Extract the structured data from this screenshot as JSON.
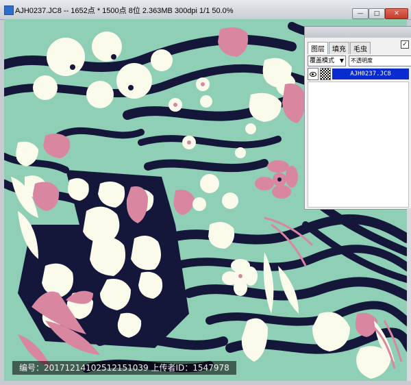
{
  "window": {
    "title": "AJH0237.JC8 -- 1652点 * 1500点 8位   2.363MB 300dpi 1/1   50.0%",
    "buttons": {
      "minimize": "—",
      "restore": "□",
      "close": "✕"
    },
    "icon": "app-icon"
  },
  "canvas": {
    "colors": {
      "mint": "#8fcfb6",
      "navy": "#14163a",
      "cream": "#fbfbec",
      "pink": "#d987a0",
      "pink_dark": "#b9607e"
    }
  },
  "layer_panel": {
    "tabs": [
      "图层",
      "填充",
      "毛虫"
    ],
    "active_tab": 0,
    "blend_mode": "覆盖模式",
    "opacity_label": "不透明度",
    "checkbox": "✓",
    "layers": [
      {
        "name": "AJH0237.JC8",
        "visible": true,
        "selected": true
      }
    ]
  },
  "watermark": {
    "text": "编号：20171214102512151039 上传者ID：1547978"
  }
}
